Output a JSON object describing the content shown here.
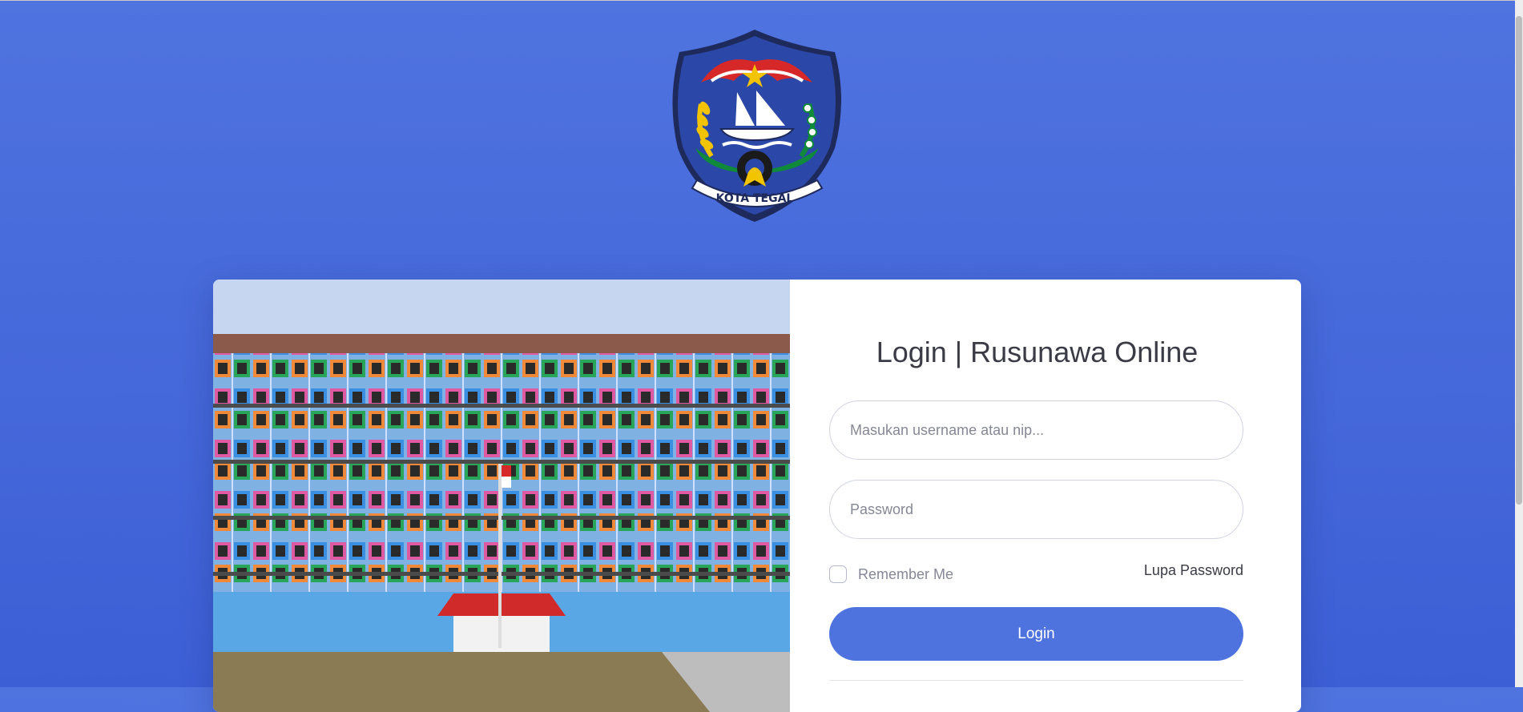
{
  "logo": {
    "text": "KOTA TEGAL",
    "colors": {
      "shield": "#243b8f",
      "flame": "#d62828",
      "gold": "#f2c400",
      "green": "#0f8a3b"
    }
  },
  "photo": {
    "description_icon": "building-photo"
  },
  "login": {
    "title": "Login | Rusunawa Online",
    "username_placeholder": "Masukan username atau nip...",
    "password_placeholder": "Password",
    "remember_label": "Remember Me",
    "forgot_label": "Lupa Password",
    "button_label": "Login"
  },
  "colors": {
    "background": "#4e73df",
    "button": "#4e73df",
    "card": "#ffffff"
  }
}
